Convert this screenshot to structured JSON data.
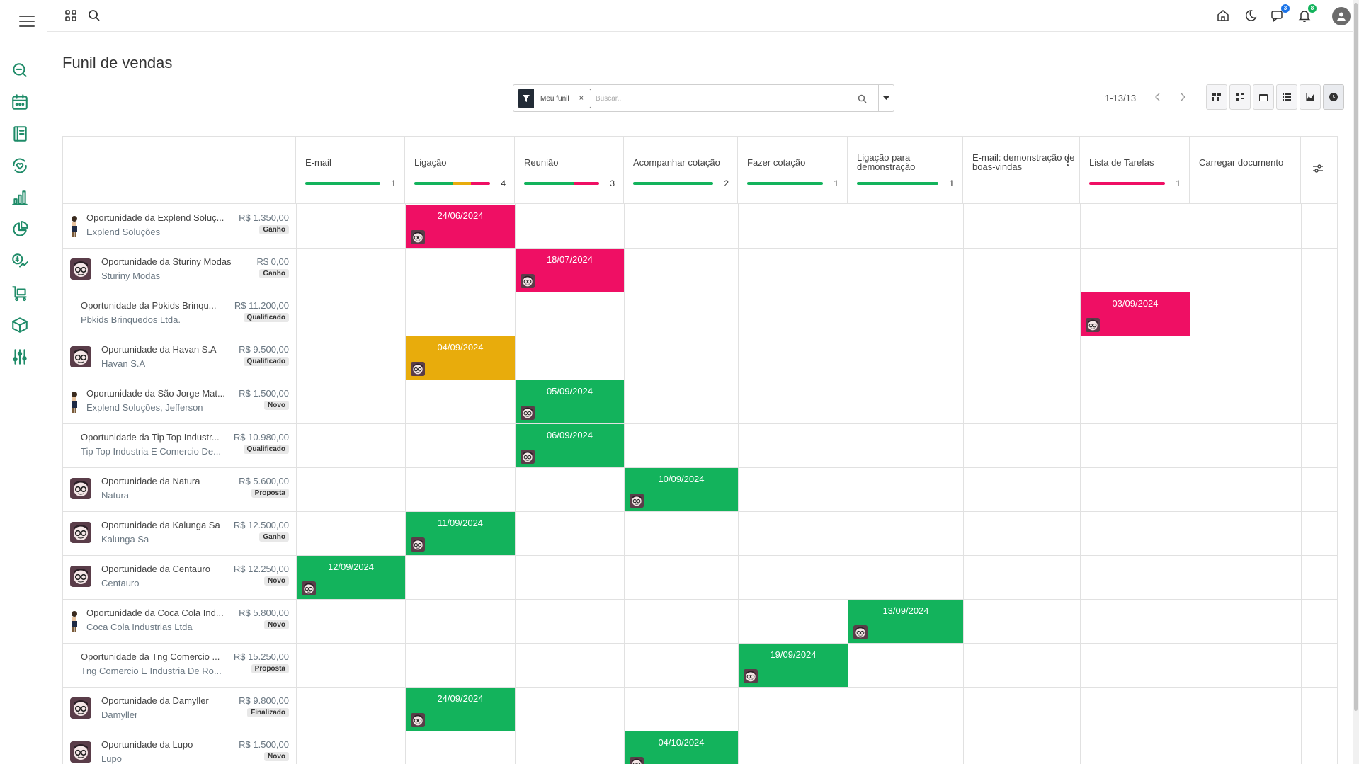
{
  "page": {
    "title": "Funil de vendas"
  },
  "topbar": {
    "chat_badge": "3",
    "bell_badge": "8"
  },
  "sidebar": {
    "icons": [
      "search-chat-icon",
      "calendar-icon",
      "notebook-icon",
      "heart-sync-icon",
      "bar-chart-icon",
      "pie-chart-icon",
      "money-trend-icon",
      "cart-icon",
      "box-icon",
      "sliders-icon"
    ]
  },
  "search": {
    "filter_label": "Meu funil",
    "filter_remove": "×",
    "placeholder": "Buscar..."
  },
  "pager": {
    "text": "1-13/13"
  },
  "colors": {
    "green": "#13b35c",
    "pink": "#ef0f64",
    "yellow": "#e8ac0c"
  },
  "stages": [
    {
      "title": "E-mail",
      "count": "1",
      "bar": [
        [
          "green",
          1
        ]
      ]
    },
    {
      "title": "Ligação",
      "count": "4",
      "bar": [
        [
          "green",
          0.5
        ],
        [
          "yellow",
          0.25
        ],
        [
          "pink",
          0.25
        ]
      ]
    },
    {
      "title": "Reunião",
      "count": "3",
      "bar": [
        [
          "green",
          0.67
        ],
        [
          "pink",
          0.33
        ]
      ]
    },
    {
      "title": "Acompanhar cotação",
      "count": "2",
      "bar": [
        [
          "green",
          1
        ]
      ]
    },
    {
      "title": "Fazer cotação",
      "count": "1",
      "bar": [
        [
          "green",
          1
        ]
      ]
    },
    {
      "title": "Ligação para demonstração",
      "count": "1",
      "bar": [
        [
          "green",
          1
        ]
      ]
    },
    {
      "title": "E-mail: demonstração de boas-vindas",
      "count": "",
      "bar": []
    },
    {
      "title": "Lista de Tarefas",
      "count": "1",
      "bar": [
        [
          "pink",
          1
        ]
      ]
    },
    {
      "title": "Carregar documento",
      "count": "",
      "bar": []
    }
  ],
  "rows": [
    {
      "name": "Oportunidade da Explend Soluç...",
      "company": "Explend Soluções",
      "price": "R$ 1.350,00",
      "status": "Ganho",
      "avatar": "tiny",
      "task": {
        "stage": 1,
        "date": "24/06/2024",
        "color": "pink"
      }
    },
    {
      "name": "Oportunidade da Sturiny Modas",
      "company": "Sturiny Modas",
      "price": "R$ 0,00",
      "status": "Ganho",
      "avatar": "face",
      "task": {
        "stage": 2,
        "date": "18/07/2024",
        "color": "pink"
      }
    },
    {
      "name": "Oportunidade da Pbkids Brinqu...",
      "company": "Pbkids Brinquedos Ltda.",
      "price": "R$ 11.200,00",
      "status": "Qualificado",
      "avatar": "none",
      "task": {
        "stage": 7,
        "date": "03/09/2024",
        "color": "pink"
      }
    },
    {
      "name": "Oportunidade da Havan S.A",
      "company": "Havan S.A",
      "price": "R$ 9.500,00",
      "status": "Qualificado",
      "avatar": "face",
      "task": {
        "stage": 1,
        "date": "04/09/2024",
        "color": "yellow"
      }
    },
    {
      "name": "Oportunidade da São Jorge Mat...",
      "company": "Explend Soluções, Jefferson",
      "price": "R$ 1.500,00",
      "status": "Novo",
      "avatar": "tiny",
      "task": {
        "stage": 2,
        "date": "05/09/2024",
        "color": "green"
      }
    },
    {
      "name": "Oportunidade da Tip Top Industr...",
      "company": "Tip Top Industria E Comercio De...",
      "price": "R$ 10.980,00",
      "status": "Qualificado",
      "avatar": "none",
      "task": {
        "stage": 2,
        "date": "06/09/2024",
        "color": "green"
      }
    },
    {
      "name": "Oportunidade da Natura",
      "company": "Natura",
      "price": "R$ 5.600,00",
      "status": "Proposta",
      "avatar": "face",
      "task": {
        "stage": 3,
        "date": "10/09/2024",
        "color": "green"
      }
    },
    {
      "name": "Oportunidade da Kalunga Sa",
      "company": "Kalunga Sa",
      "price": "R$ 12.500,00",
      "status": "Ganho",
      "avatar": "face",
      "task": {
        "stage": 1,
        "date": "11/09/2024",
        "color": "green"
      }
    },
    {
      "name": "Oportunidade da Centauro",
      "company": "Centauro",
      "price": "R$ 12.250,00",
      "status": "Novo",
      "avatar": "face",
      "task": {
        "stage": 0,
        "date": "12/09/2024",
        "color": "green"
      }
    },
    {
      "name": "Oportunidade da Coca Cola Ind...",
      "company": "Coca Cola Industrias Ltda",
      "price": "R$ 5.800,00",
      "status": "Novo",
      "avatar": "tiny",
      "task": {
        "stage": 5,
        "date": "13/09/2024",
        "color": "green"
      }
    },
    {
      "name": "Oportunidade da Tng Comercio ...",
      "company": "Tng Comercio E Industria De Ro...",
      "price": "R$ 15.250,00",
      "status": "Proposta",
      "avatar": "none",
      "task": {
        "stage": 4,
        "date": "19/09/2024",
        "color": "green"
      }
    },
    {
      "name": "Oportunidade da Damyller",
      "company": "Damyller",
      "price": "R$ 9.800,00",
      "status": "Finalizado",
      "avatar": "face",
      "task": {
        "stage": 1,
        "date": "24/09/2024",
        "color": "green"
      }
    },
    {
      "name": "Oportunidade da Lupo",
      "company": "Lupo",
      "price": "R$ 1.500,00",
      "status": "Novo",
      "avatar": "face",
      "task": {
        "stage": 3,
        "date": "04/10/2024",
        "color": "green"
      }
    }
  ]
}
